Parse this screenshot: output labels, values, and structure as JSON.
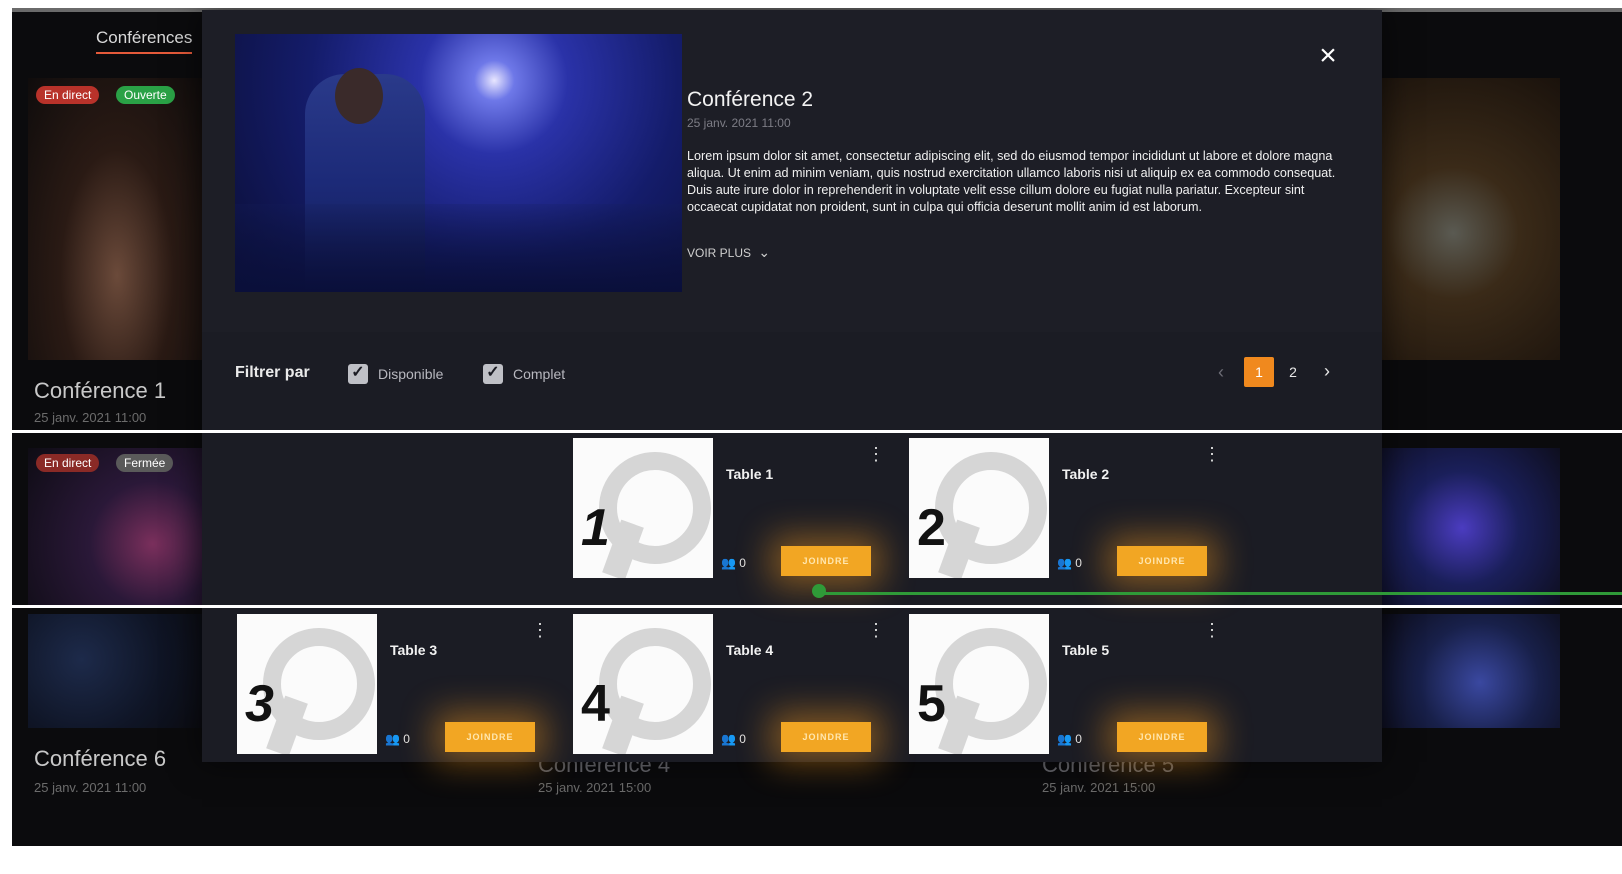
{
  "nav": {
    "tab": "Conférences"
  },
  "background_cards": [
    {
      "title": "Conférence 1",
      "date": "25 janv. 2021 11:00",
      "badges": [
        "En direct",
        "Ouverte"
      ]
    },
    {
      "title": "Conférence 6",
      "date": "25 janv. 2021 11:00",
      "badges": [
        "En direct",
        "Fermée"
      ]
    },
    {
      "title": "Conférence 4",
      "date": "25 janv. 2021 15:00"
    },
    {
      "title": "Conférence 5",
      "date": "25 janv. 2021 15:00"
    }
  ],
  "modal": {
    "title": "Conférence 2",
    "date": "25 janv. 2021 11:00",
    "description": "Lorem ipsum dolor sit amet, consectetur adipiscing elit, sed do eiusmod tempor incididunt ut labore et dolore magna aliqua. Ut enim ad minim veniam, quis nostrud exercitation ullamco laboris nisi ut aliquip ex ea commodo consequat. Duis aute irure dolor in reprehenderit in voluptate velit esse cillum dolore eu fugiat nulla pariatur. Excepteur sint occaecat cupidatat non proident, sunt in culpa qui officia deserunt mollit anim id est laborum.",
    "see_more": "VOIR PLUS",
    "close_icon": "×"
  },
  "filters": {
    "label": "Filtrer par",
    "options": [
      {
        "label": "Disponible",
        "checked": true
      },
      {
        "label": "Complet",
        "checked": true
      }
    ]
  },
  "pagination": {
    "prev": "‹",
    "pages": [
      "1",
      "2"
    ],
    "current": "1",
    "next": "›"
  },
  "tables": [
    {
      "number": "1",
      "name": "Table 1",
      "count": "0",
      "join": "JOINDRE"
    },
    {
      "number": "2",
      "name": "Table 2",
      "count": "0",
      "join": "JOINDRE"
    },
    {
      "number": "3",
      "name": "Table 3",
      "count": "0",
      "join": "JOINDRE"
    },
    {
      "number": "4",
      "name": "Table 4",
      "count": "0",
      "join": "JOINDRE"
    },
    {
      "number": "5",
      "name": "Table 5",
      "count": "0",
      "join": "JOINDRE"
    }
  ],
  "colors": {
    "accent": "#f0891e",
    "join": "#f2a623",
    "live": "#b8322a",
    "open": "#2aa146",
    "track": "#2f9a38"
  },
  "icons": {
    "check": "✓",
    "people": "👥",
    "chevron": "⌄",
    "kebab": "⋮"
  }
}
